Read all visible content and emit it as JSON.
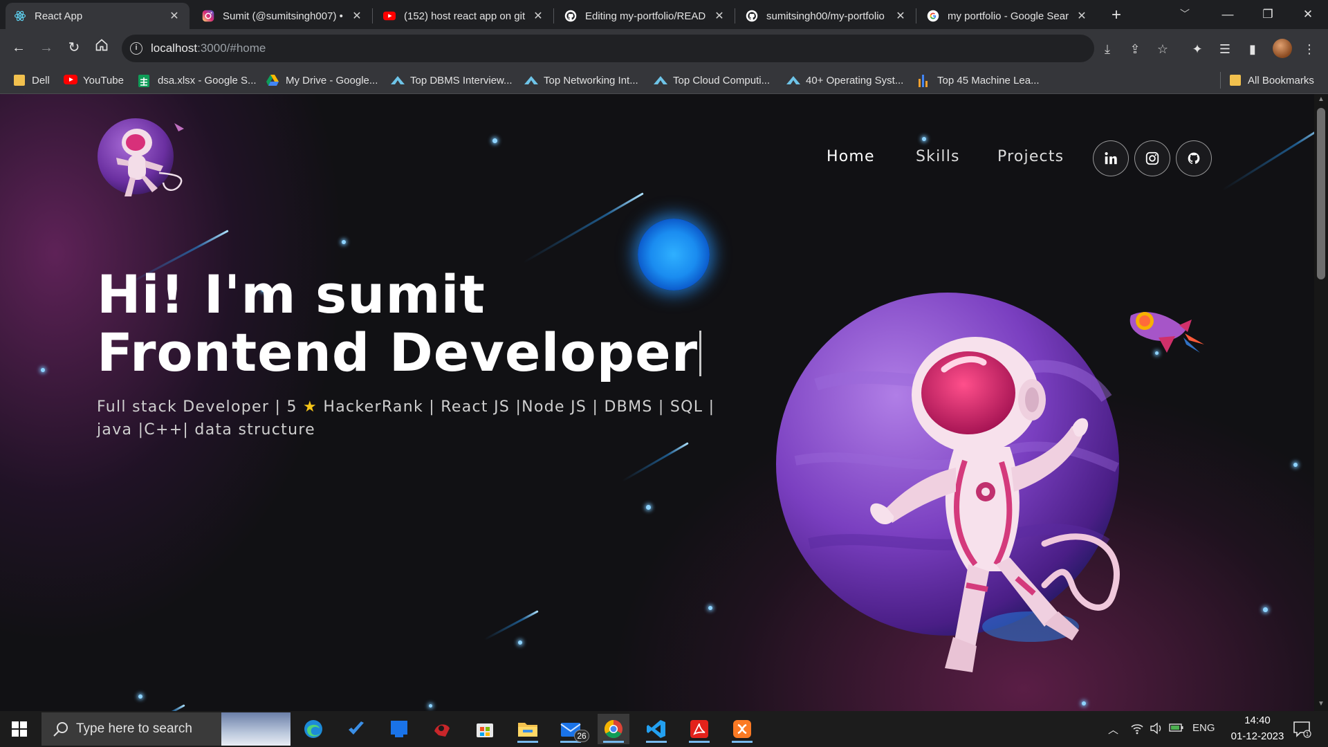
{
  "browser": {
    "tabs": [
      {
        "title": "React App",
        "icon": "react-icon",
        "active": true
      },
      {
        "title": "Sumit (@sumitsingh007) •",
        "icon": "instagram-icon"
      },
      {
        "title": "(152) host react app on git",
        "icon": "youtube-icon"
      },
      {
        "title": "Editing my-portfolio/READ",
        "icon": "github-icon"
      },
      {
        "title": "sumitsingh00/my-portfolio",
        "icon": "github-icon"
      },
      {
        "title": "my portfolio - Google Sear",
        "icon": "google-icon"
      }
    ],
    "url": {
      "host": "localhost",
      "rest": ":3000/#home"
    },
    "bookmarks": [
      {
        "label": "Dell",
        "icon": "folder-icon"
      },
      {
        "label": "YouTube",
        "icon": "youtube-icon"
      },
      {
        "label": "dsa.xlsx - Google S...",
        "icon": "google-sheets-icon"
      },
      {
        "label": "My Drive - Google...",
        "icon": "google-drive-icon"
      },
      {
        "label": "Top DBMS Interview...",
        "icon": "interviewbit-icon"
      },
      {
        "label": "Top Networking Int...",
        "icon": "interviewbit-icon"
      },
      {
        "label": "Top Cloud Computi...",
        "icon": "interviewbit-icon"
      },
      {
        "label": "40+ Operating Syst...",
        "icon": "interviewbit-icon"
      },
      {
        "label": "Top 45 Machine Lea...",
        "icon": "bar-chart-icon"
      }
    ],
    "all_bookmarks": "All Bookmarks"
  },
  "site": {
    "nav": {
      "home": "Home",
      "skills": "Skills",
      "projects": "Projects"
    },
    "social": [
      "linkedin-icon",
      "instagram-icon",
      "github-icon"
    ],
    "hero": {
      "title": "Hi! I'm sumit Frontend Developer",
      "subtitle_before_star": "Full stack Developer | 5 ",
      "star": "★",
      "subtitle_after_star": " HackerRank | React JS |Node JS | DBMS | SQL | java |C++| data structure"
    }
  },
  "taskbar": {
    "search_placeholder": "Type here to search",
    "apps": [
      "edge-icon",
      "todo-icon",
      "app-icon",
      "game-icon",
      "microsoft-store-icon",
      "file-explorer-icon",
      "mail-icon",
      "chrome-icon",
      "vscode-icon",
      "acrobat-icon",
      "xampp-icon"
    ],
    "mail_badge": "26",
    "language": "ENG",
    "time": "14:40",
    "date": "01-12-2023"
  },
  "colors": {
    "page_bg": "#111114",
    "accent_purple": "#7a3fb0",
    "accent_blue": "#2fb0ff",
    "star_gold": "#f5c518"
  }
}
